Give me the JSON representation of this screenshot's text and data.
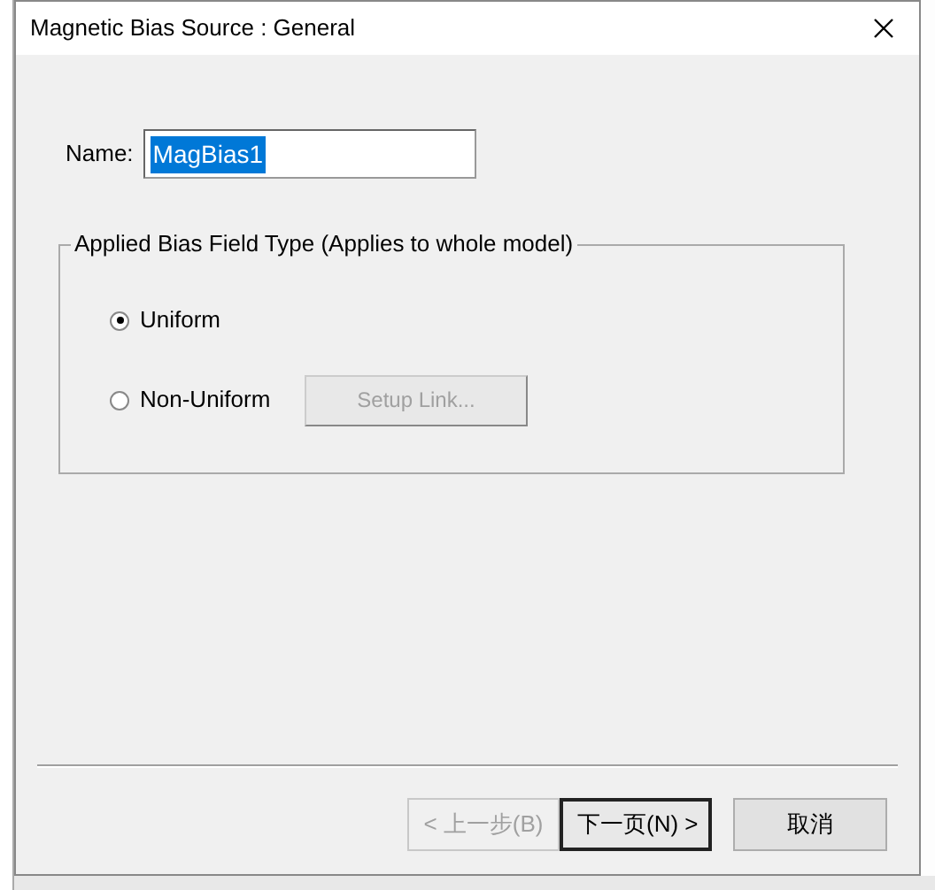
{
  "window": {
    "title": "Magnetic Bias Source : General"
  },
  "name_field": {
    "label": "Name:",
    "value": "MagBias1",
    "selected": true
  },
  "group": {
    "title": "Applied Bias Field Type (Applies to whole model)",
    "options": [
      {
        "label": "Uniform",
        "selected": true
      },
      {
        "label": "Non-Uniform",
        "selected": false,
        "button": {
          "label": "Setup Link...",
          "disabled": true
        }
      }
    ]
  },
  "buttons": [
    {
      "kind": "back",
      "label": "< 上一步(B)",
      "disabled": true
    },
    {
      "kind": "next",
      "label": "下一页(N) >",
      "disabled": false,
      "default": true
    },
    {
      "kind": "cancel",
      "label": "取消",
      "disabled": false,
      "default": false
    }
  ]
}
